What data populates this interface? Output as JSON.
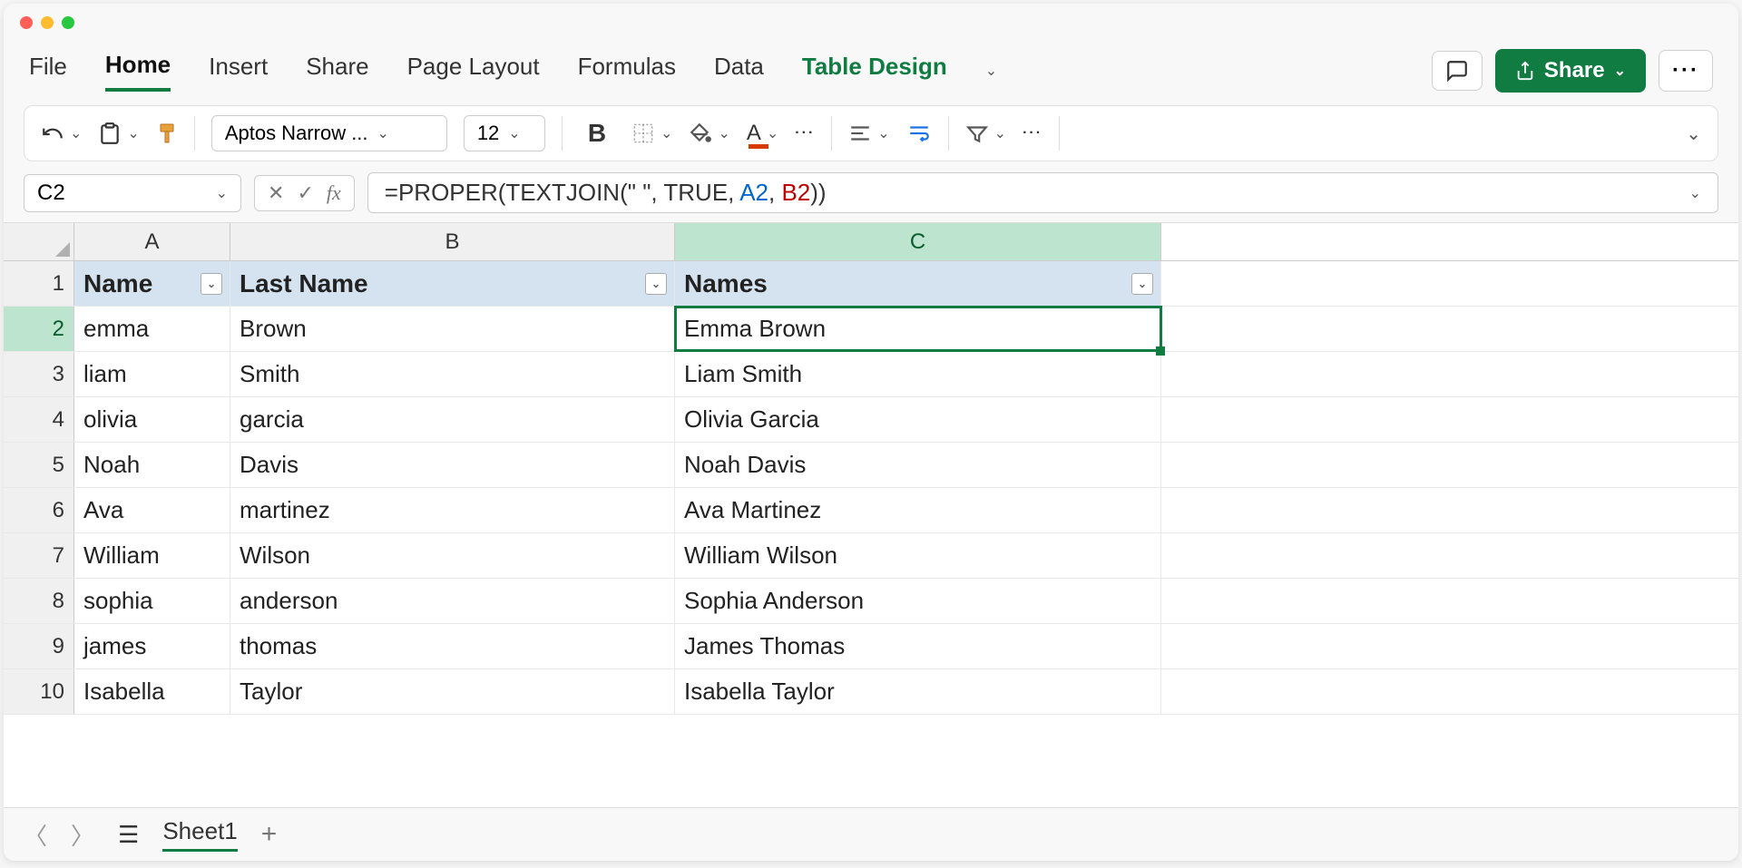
{
  "ribbon": {
    "tabs": [
      "File",
      "Home",
      "Insert",
      "Share",
      "Page Layout",
      "Formulas",
      "Data",
      "Table Design"
    ],
    "active": "Home",
    "share_label": "Share"
  },
  "toolbar": {
    "font_name": "Aptos Narrow ...",
    "font_size": "12"
  },
  "formula": {
    "cell_ref": "C2",
    "prefix": "=PROPER(TEXTJOIN(\" \", TRUE, ",
    "arg1": "A2",
    "sep": ", ",
    "arg2": "B2",
    "suffix": "))"
  },
  "columns": [
    "A",
    "B",
    "C"
  ],
  "headers": {
    "A": "Name",
    "B": "Last Name",
    "C": "Names"
  },
  "rows": [
    {
      "n": "1",
      "A": "Name",
      "B": "Last Name",
      "C": "Names"
    },
    {
      "n": "2",
      "A": "emma",
      "B": "Brown",
      "C": "Emma Brown"
    },
    {
      "n": "3",
      "A": "liam",
      "B": "Smith",
      "C": "Liam Smith"
    },
    {
      "n": "4",
      "A": "olivia",
      "B": "garcia",
      "C": "Olivia Garcia"
    },
    {
      "n": "5",
      "A": "Noah",
      "B": "Davis",
      "C": "Noah Davis"
    },
    {
      "n": "6",
      "A": "Ava",
      "B": "martinez",
      "C": "Ava Martinez"
    },
    {
      "n": "7",
      "A": "William",
      "B": "Wilson",
      "C": "William Wilson"
    },
    {
      "n": "8",
      "A": "sophia",
      "B": "anderson",
      "C": "Sophia Anderson"
    },
    {
      "n": "9",
      "A": "james",
      "B": "thomas",
      "C": "James Thomas"
    },
    {
      "n": "10",
      "A": "Isabella",
      "B": "Taylor",
      "C": "Isabella Taylor"
    }
  ],
  "sheet": {
    "name": "Sheet1"
  },
  "selected": {
    "row": 2,
    "col": "C"
  }
}
